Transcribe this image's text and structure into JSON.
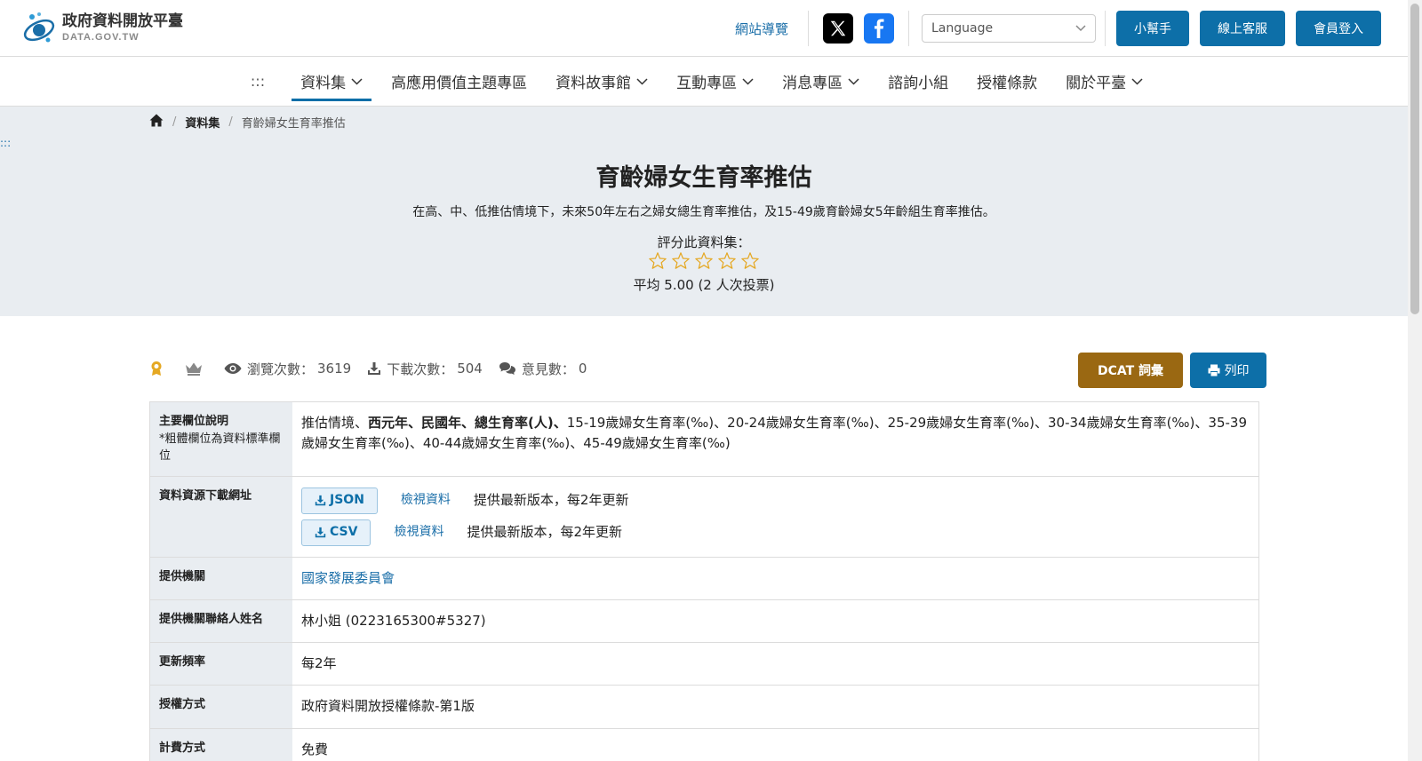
{
  "header": {
    "logo_title": "政府資料開放平臺",
    "logo_sub": "DATA.GOV.TW",
    "sitemap_label": "網站導覽",
    "language_placeholder": "Language",
    "helper_label": "小幫手",
    "support_label": "線上客服",
    "login_label": "會員登入"
  },
  "nav": {
    "dots": ":::",
    "items": [
      {
        "label": "資料集",
        "dropdown": true,
        "active": true
      },
      {
        "label": "高應用價值主題專區",
        "dropdown": false
      },
      {
        "label": "資料故事館",
        "dropdown": true
      },
      {
        "label": "互動專區",
        "dropdown": true
      },
      {
        "label": "消息專區",
        "dropdown": true
      },
      {
        "label": "諮詢小組",
        "dropdown": false
      },
      {
        "label": "授權條款",
        "dropdown": false
      },
      {
        "label": "關於平臺",
        "dropdown": true
      }
    ]
  },
  "breadcrumb": {
    "home_icon": "home-icon",
    "section": "資料集",
    "current": "育齡婦女生育率推估"
  },
  "side_dots": ":::",
  "dataset": {
    "title": "育齡婦女生育率推估",
    "description": "在高、中、低推估情境下，未來50年左右之婦女總生育率推估，及15-49歲育齡婦女5年齡組生育率推估。",
    "rate_label": "評分此資料集：",
    "stars_total": 5,
    "average_text": "平均 5.00 (2 人次投票)"
  },
  "stats": {
    "views_label": "瀏覽次數：",
    "views_value": "3619",
    "downloads_label": "下載次數：",
    "downloads_value": "504",
    "comments_label": "意見數：",
    "comments_value": "0"
  },
  "actions": {
    "dcat_label": "DCAT 詞彙",
    "print_label": "列印"
  },
  "table": {
    "fields_header": "主要欄位說明",
    "fields_note": "*粗體欄位為資料標準欄位",
    "fields_plain_1": "推估情境、",
    "fields_bold": "西元年、民國年、總生育率(人)、",
    "fields_plain_2": "15-19歲婦女生育率(‰)、20-24歲婦女生育率(‰)、25-29歲婦女生育率(‰)、30-34歲婦女生育率(‰)、35-39歲婦女生育率(‰)、40-44歲婦女生育率(‰)、45-49歲婦女生育率(‰)",
    "download_header": "資料資源下載網址",
    "downloads": [
      {
        "format": "JSON",
        "view": "檢視資料",
        "note": "提供最新版本，每2年更新"
      },
      {
        "format": "CSV",
        "view": "檢視資料",
        "note": "提供最新版本，每2年更新"
      }
    ],
    "agency_header": "提供機關",
    "agency_value": "國家發展委員會",
    "contact_header": "提供機關聯絡人姓名",
    "contact_value": "林小姐 (0223165300#5327)",
    "frequency_header": "更新頻率",
    "frequency_value": "每2年",
    "license_header": "授權方式",
    "license_value": "政府資料開放授權條款-第1版",
    "fee_header": "計費方式",
    "fee_value": "免費"
  },
  "colors": {
    "primary_blue": "#0d6fa8",
    "dcat_brown": "#9a6812",
    "hero_bg": "#e9edf1",
    "star": "#e5a823"
  }
}
